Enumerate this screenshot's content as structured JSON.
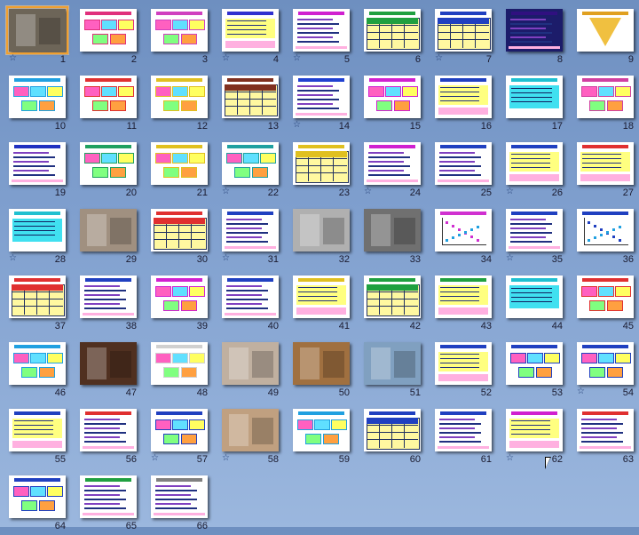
{
  "slide_sorter": {
    "slides": [
      {
        "n": "1",
        "t": "photo",
        "star": true,
        "selected": true,
        "c": "#6d6558"
      },
      {
        "n": "2",
        "t": "diagram",
        "c": "#e0307c"
      },
      {
        "n": "3",
        "t": "diagram",
        "c": "#d040c0"
      },
      {
        "n": "4",
        "t": "yellow",
        "star": true,
        "c": "#3030d0"
      },
      {
        "n": "5",
        "t": "text",
        "star": true,
        "c": "#d020d0"
      },
      {
        "n": "6",
        "t": "table",
        "c": "#20a040"
      },
      {
        "n": "7",
        "t": "table",
        "star": true,
        "c": "#2040c0"
      },
      {
        "n": "8",
        "t": "dark",
        "c": "#301080"
      },
      {
        "n": "9",
        "t": "pyramid",
        "c": "#e0a020"
      },
      {
        "n": "10",
        "t": "diagram",
        "c": "#20a0e0"
      },
      {
        "n": "11",
        "t": "diagram",
        "c": "#e03030"
      },
      {
        "n": "12",
        "t": "diagram",
        "c": "#e0c020"
      },
      {
        "n": "13",
        "t": "table",
        "c": "#803020"
      },
      {
        "n": "14",
        "t": "text",
        "star": true,
        "c": "#2040d0"
      },
      {
        "n": "15",
        "t": "diagram",
        "c": "#d020d0"
      },
      {
        "n": "16",
        "t": "yellow",
        "c": "#2040c0"
      },
      {
        "n": "17",
        "t": "cyan",
        "c": "#20c0d0"
      },
      {
        "n": "18",
        "t": "diagram",
        "c": "#d040a0"
      },
      {
        "n": "19",
        "t": "text",
        "c": "#2030c0"
      },
      {
        "n": "20",
        "t": "diagram",
        "c": "#20a060"
      },
      {
        "n": "21",
        "t": "diagram",
        "c": "#e0c020"
      },
      {
        "n": "22",
        "t": "diagram",
        "star": true,
        "c": "#20a0a0"
      },
      {
        "n": "23",
        "t": "table",
        "c": "#e0c020"
      },
      {
        "n": "24",
        "t": "text",
        "star": true,
        "c": "#d020d0"
      },
      {
        "n": "25",
        "t": "text",
        "c": "#2040c0"
      },
      {
        "n": "26",
        "t": "yellow",
        "star": true,
        "c": "#2040c0"
      },
      {
        "n": "27",
        "t": "yellow",
        "c": "#e03030"
      },
      {
        "n": "28",
        "t": "cyan",
        "star": true,
        "c": "#20c0d0"
      },
      {
        "n": "29",
        "t": "photo",
        "c": "#a09080"
      },
      {
        "n": "30",
        "t": "table",
        "c": "#e03030"
      },
      {
        "n": "31",
        "t": "text",
        "star": true,
        "c": "#2040c0"
      },
      {
        "n": "32",
        "t": "photo",
        "c": "#b0b0b0"
      },
      {
        "n": "33",
        "t": "photo",
        "c": "#707070"
      },
      {
        "n": "34",
        "t": "chart",
        "c": "#d030d0"
      },
      {
        "n": "35",
        "t": "text",
        "star": true,
        "c": "#2040c0"
      },
      {
        "n": "36",
        "t": "chart",
        "c": "#2040c0"
      },
      {
        "n": "37",
        "t": "table",
        "c": "#e03030"
      },
      {
        "n": "38",
        "t": "text",
        "c": "#2040c0"
      },
      {
        "n": "39",
        "t": "diagram",
        "c": "#d020d0"
      },
      {
        "n": "40",
        "t": "text",
        "c": "#2040c0"
      },
      {
        "n": "41",
        "t": "yellow",
        "c": "#e0c020"
      },
      {
        "n": "42",
        "t": "table",
        "c": "#20a040"
      },
      {
        "n": "43",
        "t": "yellow",
        "c": "#20a040"
      },
      {
        "n": "44",
        "t": "cyan",
        "c": "#20c0d0"
      },
      {
        "n": "45",
        "t": "diagram",
        "c": "#e03030"
      },
      {
        "n": "46",
        "t": "diagram",
        "c": "#20a0e0"
      },
      {
        "n": "47",
        "t": "photo",
        "c": "#503020"
      },
      {
        "n": "48",
        "t": "diagram",
        "c": "#d0d0d0"
      },
      {
        "n": "49",
        "t": "photo",
        "c": "#c0b0a0"
      },
      {
        "n": "50",
        "t": "photo",
        "c": "#a07040"
      },
      {
        "n": "51",
        "t": "photo",
        "c": "#80a0c0"
      },
      {
        "n": "52",
        "t": "yellow",
        "c": "#2040c0"
      },
      {
        "n": "53",
        "t": "diagram",
        "c": "#2040c0"
      },
      {
        "n": "54",
        "t": "diagram",
        "star": true,
        "c": "#2040c0"
      },
      {
        "n": "55",
        "t": "yellow",
        "c": "#2040c0"
      },
      {
        "n": "56",
        "t": "text",
        "c": "#e03030"
      },
      {
        "n": "57",
        "t": "diagram",
        "star": true,
        "c": "#2040c0"
      },
      {
        "n": "58",
        "t": "photo",
        "star": true,
        "c": "#c0a080"
      },
      {
        "n": "59",
        "t": "diagram",
        "c": "#20a0e0"
      },
      {
        "n": "60",
        "t": "table",
        "c": "#2040c0"
      },
      {
        "n": "61",
        "t": "text",
        "c": "#2040c0"
      },
      {
        "n": "62",
        "t": "yellow",
        "star": true,
        "c": "#d020d0"
      },
      {
        "n": "63",
        "t": "text",
        "c": "#e03030"
      },
      {
        "n": "64",
        "t": "diagram",
        "c": "#2040c0"
      },
      {
        "n": "65",
        "t": "text",
        "c": "#20a040"
      },
      {
        "n": "66",
        "t": "text",
        "c": "#808080"
      }
    ]
  }
}
